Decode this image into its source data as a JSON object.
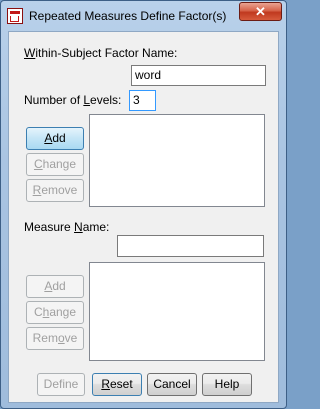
{
  "window": {
    "title": "Repeated Measures Define Factor(s)",
    "close_glyph": "✕"
  },
  "factor": {
    "name_label_prefix": "W",
    "name_label_rest": "ithin-Subject Factor Name:",
    "name_value": "word",
    "levels_label_prefix": "Number of ",
    "levels_label_u": "L",
    "levels_label_rest": "evels:",
    "levels_value": "3"
  },
  "factor_buttons": {
    "add": {
      "u": "A",
      "rest": "dd"
    },
    "change": {
      "u": "C",
      "rest": "hange"
    },
    "remove": {
      "u": "R",
      "rest": "emove"
    }
  },
  "measure": {
    "label_prefix": "Measure ",
    "label_u": "N",
    "label_rest": "ame:",
    "value": ""
  },
  "measure_buttons": {
    "add": {
      "u": "A",
      "rest": "dd"
    },
    "change": {
      "pre": "C",
      "u": "h",
      "rest": "ange"
    },
    "remove": {
      "pre": "Rem",
      "u": "o",
      "rest": "ve"
    }
  },
  "footer": {
    "define": "Define",
    "reset": {
      "u": "R",
      "rest": "eset"
    },
    "cancel": "Cancel",
    "help": "Help"
  }
}
